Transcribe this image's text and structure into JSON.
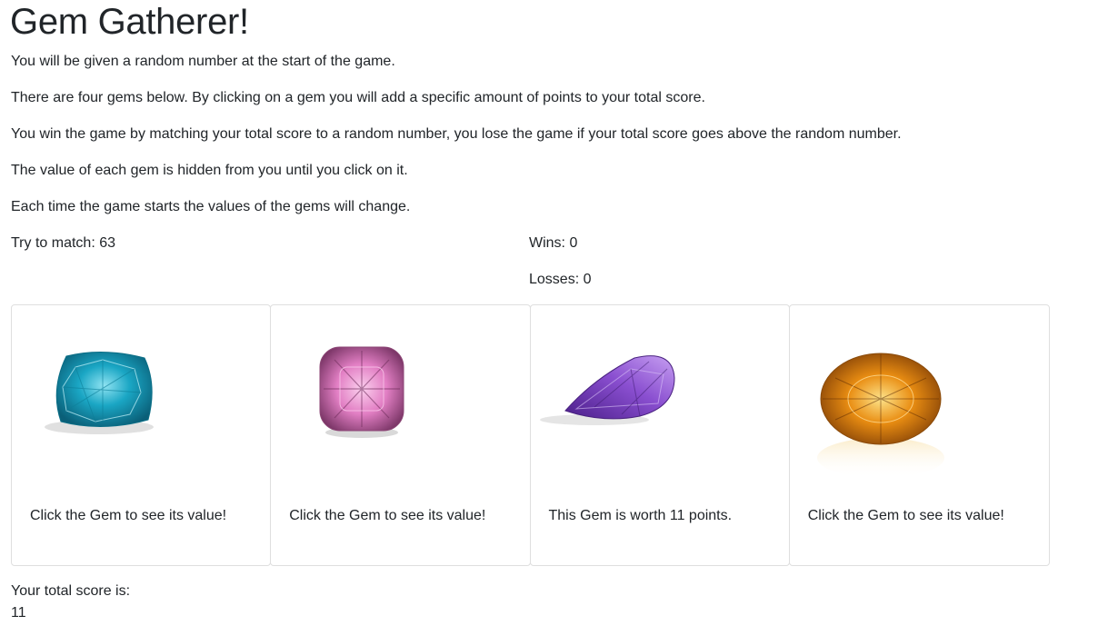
{
  "title": "Gem Gatherer!",
  "instructions": [
    "You will be given a random number at the start of the game.",
    "There are four gems below. By clicking on a gem you will add a specific amount of points to your total score.",
    "You win the game by matching your total score to a random number, you lose the game if your total score goes above the random number.",
    "The value of each gem is hidden from you until you click on it.",
    "Each time the game starts the values of the gems will change."
  ],
  "stats": {
    "target": "Try to match: 63",
    "wins": "Wins: 0",
    "losses": "Losses: 0"
  },
  "gems": [
    {
      "name": "blue-gem",
      "color": "#1aa6c4",
      "text": "Click the Gem to see its value!"
    },
    {
      "name": "pink-gem",
      "color": "#e27fc4",
      "text": "Click the Gem to see its value!"
    },
    {
      "name": "purple-gem",
      "color": "#8a4fd0",
      "text": "This Gem is worth 11 points."
    },
    {
      "name": "orange-gem",
      "color": "#e98d12",
      "text": "Click the Gem to see its value!"
    }
  ],
  "score": {
    "label": "Your total score is:",
    "value": "11"
  }
}
